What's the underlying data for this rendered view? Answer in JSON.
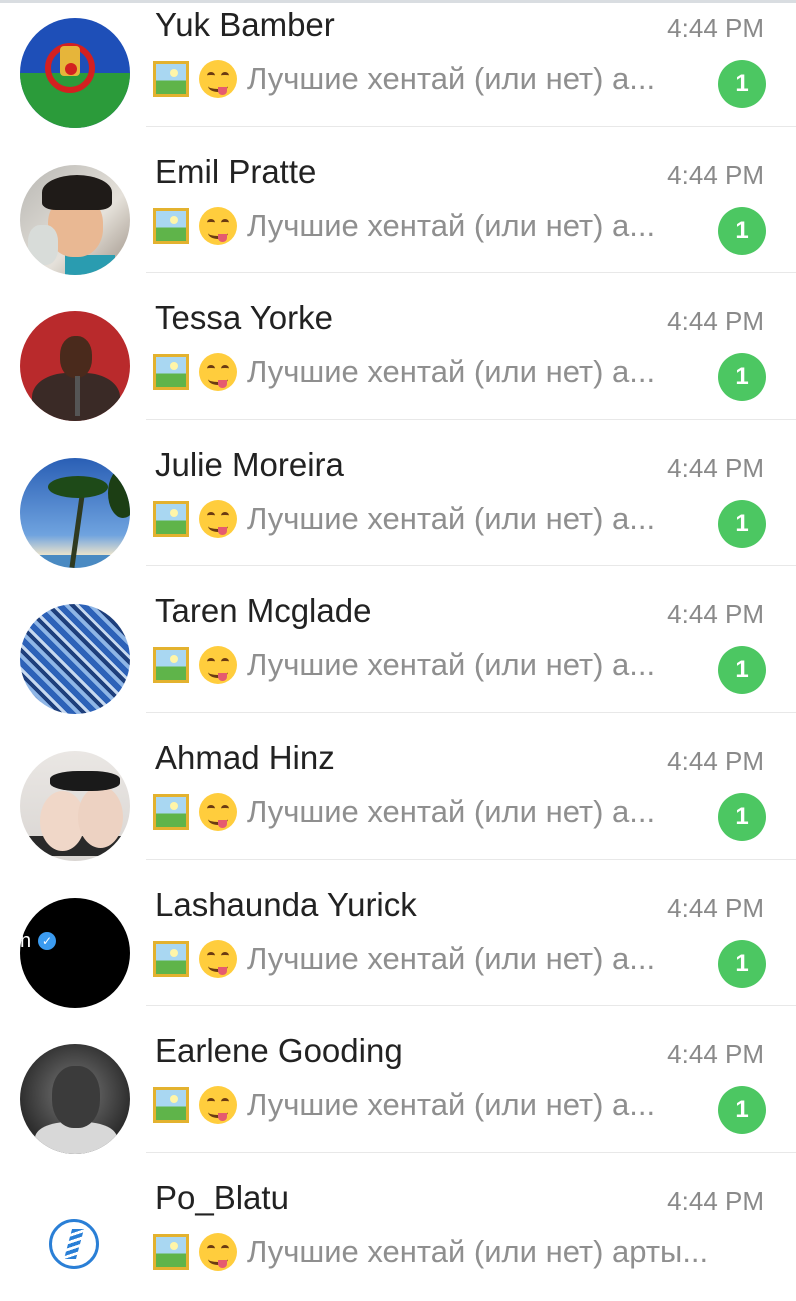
{
  "chats": [
    {
      "name": "Yuk Bamber",
      "time": "4:44 PM",
      "preview": "Лучшие хентай (или нет) а...",
      "unread": "1",
      "avatar": "romani-flag"
    },
    {
      "name": "Emil Pratte",
      "time": "4:44 PM",
      "preview": "Лучшие хентай (или нет) а...",
      "unread": "1",
      "avatar": "child-photo"
    },
    {
      "name": "Tessa Yorke",
      "time": "4:44 PM",
      "preview": "Лучшие хентай (или нет) а...",
      "unread": "1",
      "avatar": "speaker-photo"
    },
    {
      "name": "Julie Moreira",
      "time": "4:44 PM",
      "preview": "Лучшие хентай (или нет) а...",
      "unread": "1",
      "avatar": "palm-beach"
    },
    {
      "name": "Taren Mcglade",
      "time": "4:44 PM",
      "preview": "Лучшие хентай (или нет) а...",
      "unread": "1",
      "avatar": "blue-city"
    },
    {
      "name": "Ahmad Hinz",
      "time": "4:44 PM",
      "preview": "Лучшие хентай (или нет) а...",
      "unread": "1",
      "avatar": "photo"
    },
    {
      "name": "Lashaunda Yurick",
      "time": "4:44 PM",
      "preview": "Лучшие хентай (или нет) а...",
      "unread": "1",
      "avatar": "black-verified",
      "avatar_text": "n"
    },
    {
      "name": "Earlene Gooding",
      "time": "4:44 PM",
      "preview": "Лучшие хентай (или нет) а...",
      "unread": "1",
      "avatar": "portrait-bw"
    },
    {
      "name": "Po_Blatu",
      "time": "4:44 PM",
      "preview": "Лучшие хентай (или нет) арты...",
      "unread": "",
      "avatar": "blue-logo"
    }
  ],
  "icons": {
    "picture": "picture-icon",
    "emoji": "yum-emoji-icon"
  },
  "colors": {
    "badge": "#4cc762",
    "time": "#8a8a8a",
    "preview": "#8f8f8f",
    "name": "#222222"
  }
}
